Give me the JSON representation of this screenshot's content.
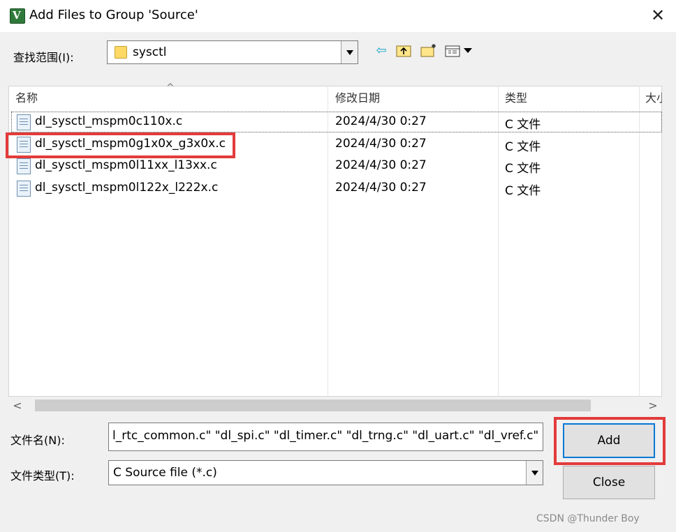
{
  "window": {
    "title": "Add Files to Group 'Source'",
    "close_glyph": "✕",
    "app_icon_glyph": "V"
  },
  "lookin": {
    "label": "查找范围(I):",
    "value": "sysctl"
  },
  "toolbar": {
    "icons": [
      "back-arrow-icon",
      "up-folder-icon",
      "new-folder-icon",
      "view-menu-icon"
    ]
  },
  "filelist": {
    "headers": [
      "名称",
      "修改日期",
      "类型",
      "大小"
    ],
    "rows": [
      {
        "name": "dl_sysctl_mspm0c110x.c",
        "date": "2024/4/30 0:27",
        "type": "C 文件"
      },
      {
        "name": "dl_sysctl_mspm0g1x0x_g3x0x.c",
        "date": "2024/4/30 0:27",
        "type": "C 文件"
      },
      {
        "name": "dl_sysctl_mspm0l11xx_l13xx.c",
        "date": "2024/4/30 0:27",
        "type": "C 文件"
      },
      {
        "name": "dl_sysctl_mspm0l122x_l222x.c",
        "date": "2024/4/30 0:27",
        "type": "C 文件"
      }
    ]
  },
  "filename": {
    "label": "文件名(N):",
    "value": "l_rtc_common.c\" \"dl_spi.c\" \"dl_timer.c\" \"dl_trng.c\" \"dl_uart.c\" \"dl_vref.c\""
  },
  "filetype": {
    "label": "文件类型(T):",
    "value": "C Source file (*.c)"
  },
  "buttons": {
    "add": "Add",
    "close": "Close"
  },
  "watermark": "CSDN @Thunder Boy"
}
